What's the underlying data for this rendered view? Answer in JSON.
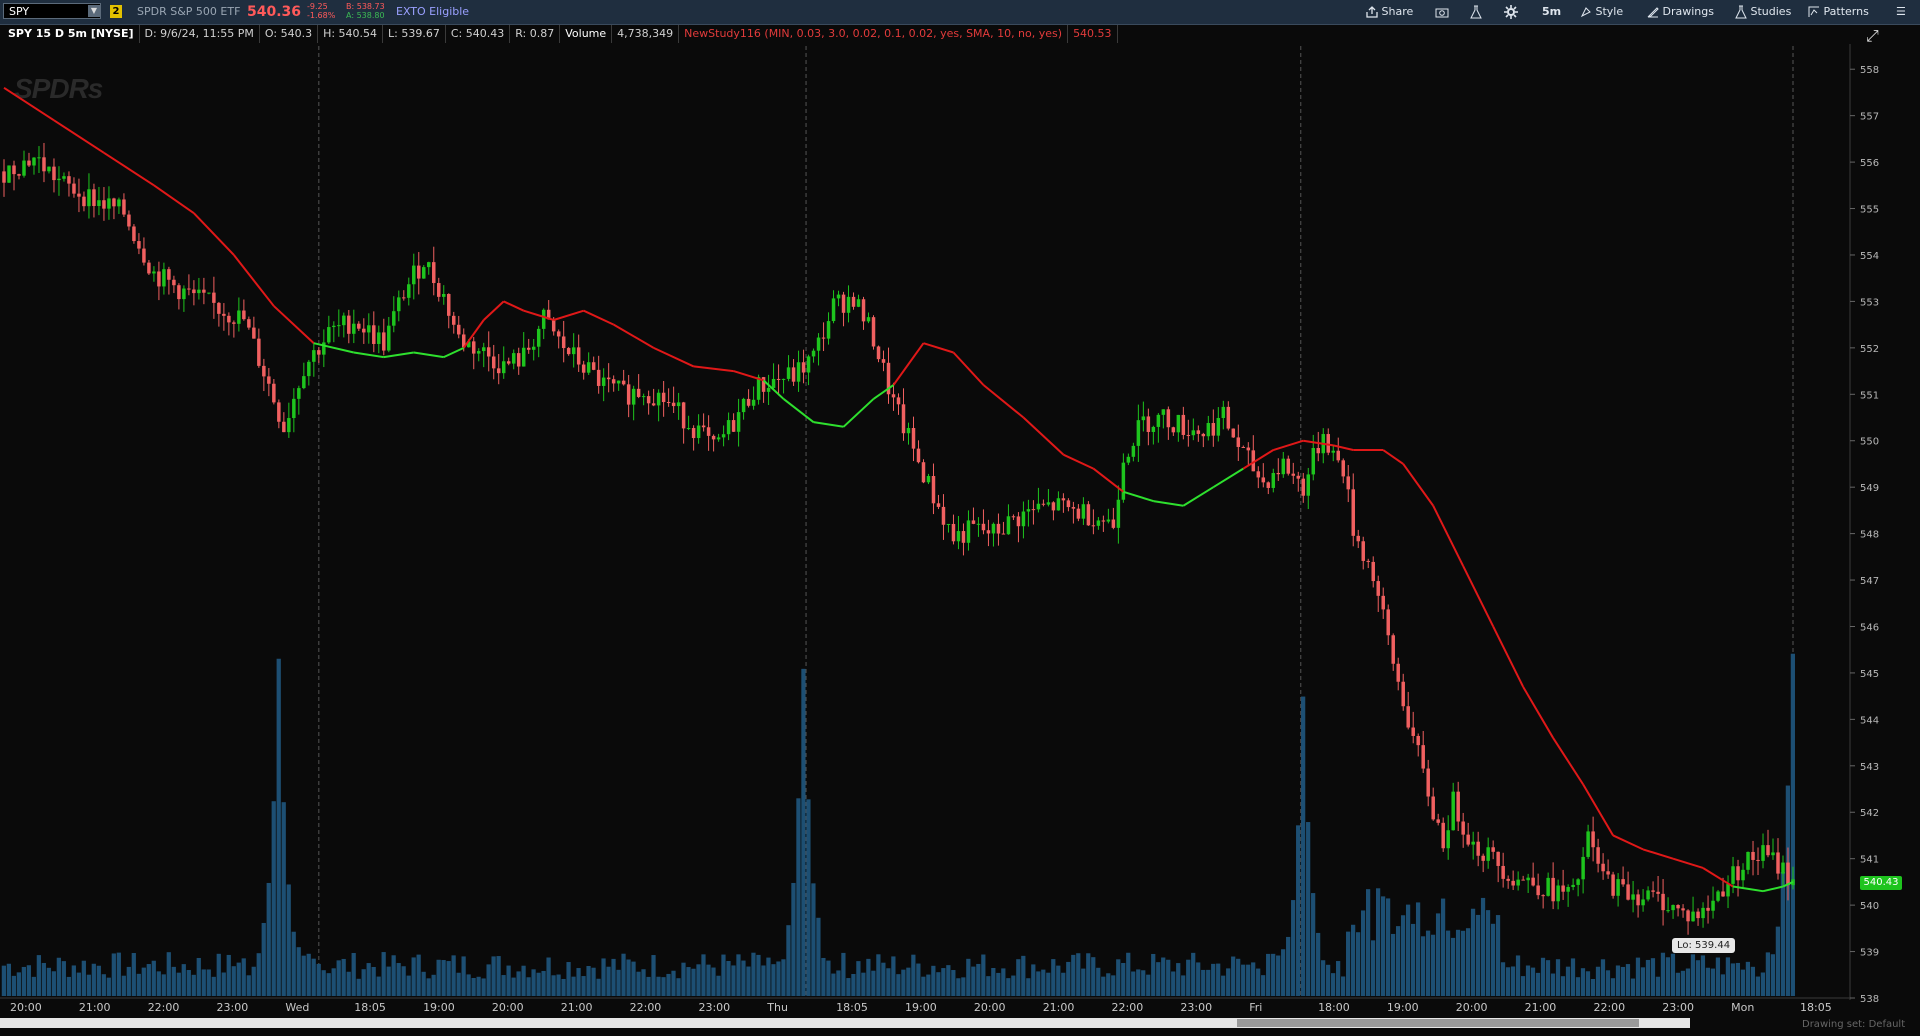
{
  "toolbar": {
    "symbol": "SPY",
    "link_badge": "2",
    "description": "SPDR S&P 500 ETF",
    "last_price": "540.36",
    "net_change": "-9.25",
    "pct_change": "-1.68%",
    "bid": "B: 538.73",
    "ask": "A: 538.80",
    "exto": "EXTO Eligible",
    "share_label": "Share",
    "aggregation": "5m",
    "style_label": "Style",
    "drawings_label": "Drawings",
    "studies_label": "Studies",
    "patterns_label": "Patterns"
  },
  "infobar": {
    "title": "SPY 15 D 5m [NYSE]",
    "date": "D: 9/6/24, 11:55 PM",
    "open": "O: 540.3",
    "high": "H: 540.54",
    "low": "L: 539.67",
    "close": "C: 540.43",
    "range": "R: 0.87",
    "volume_label": "Volume",
    "volume_value": "4,738,349",
    "study_label": "NewStudy116 (MIN, 0.03, 3.0, 0.02, 0.1, 0.02, yes, SMA, 10, no, yes)",
    "study_value": "540.53"
  },
  "watermark": "SPDRs",
  "price_tag": "540.43",
  "low_tag": "Lo: 539.44",
  "drawing_set": "Drawing set: Default",
  "colors": {
    "up": "#1ec41e",
    "down": "#f06060",
    "ma_red": "#e01818",
    "ma_green": "#2ee02e",
    "volume": "#1d4f73"
  },
  "chart_data": {
    "type": "candlestick",
    "symbol": "SPY",
    "interval": "5m",
    "ylim": [
      538,
      558.5
    ],
    "y_ticks": [
      "558",
      "557",
      "556",
      "555",
      "554",
      "553",
      "552",
      "551",
      "550",
      "549",
      "548",
      "547",
      "546",
      "545",
      "544",
      "543",
      "542",
      "541",
      "540",
      "539",
      "538"
    ],
    "x_ticks": [
      "20:00",
      "21:00",
      "22:00",
      "23:00",
      "Wed",
      "18:05",
      "19:00",
      "20:00",
      "21:00",
      "22:00",
      "23:00",
      "Thu",
      "18:05",
      "19:00",
      "20:00",
      "21:00",
      "22:00",
      "23:00",
      "Fri",
      "18:00",
      "19:00",
      "20:00",
      "21:00",
      "22:00",
      "23:00",
      "Mon",
      "18:05"
    ],
    "session_breaks": [
      "Wed",
      "Thu",
      "Fri",
      "Mon"
    ],
    "price_path": [
      [
        0,
        555.8
      ],
      [
        6,
        556.1
      ],
      [
        12,
        555.5
      ],
      [
        18,
        555.2
      ],
      [
        24,
        554.9
      ],
      [
        30,
        553.6
      ],
      [
        36,
        553.2
      ],
      [
        42,
        552.9
      ],
      [
        48,
        552.6
      ],
      [
        53,
        551.2
      ],
      [
        56,
        550.3
      ],
      [
        60,
        551.6
      ],
      [
        65,
        552.3
      ],
      [
        70,
        552.6
      ],
      [
        76,
        552.1
      ],
      [
        80,
        553.2
      ],
      [
        84,
        553.9
      ],
      [
        88,
        553.1
      ],
      [
        91,
        552.2
      ],
      [
        96,
        551.9
      ],
      [
        100,
        551.6
      ],
      [
        104,
        551.8
      ],
      [
        108,
        552.6
      ],
      [
        112,
        552.0
      ],
      [
        116,
        551.6
      ],
      [
        120,
        551.2
      ],
      [
        124,
        551.0
      ],
      [
        128,
        551.1
      ],
      [
        132,
        550.9
      ],
      [
        136,
        550.5
      ],
      [
        140,
        550.1
      ],
      [
        142,
        549.8
      ],
      [
        146,
        550.4
      ],
      [
        150,
        551.1
      ],
      [
        154,
        551.3
      ],
      [
        158,
        551.4
      ],
      [
        162,
        551.8
      ],
      [
        166,
        552.9
      ],
      [
        170,
        553.1
      ],
      [
        174,
        552.2
      ],
      [
        178,
        550.8
      ],
      [
        182,
        549.8
      ],
      [
        186,
        548.8
      ],
      [
        190,
        547.9
      ],
      [
        194,
        548.1
      ],
      [
        198,
        548.0
      ],
      [
        202,
        548.3
      ],
      [
        206,
        548.5
      ],
      [
        210,
        548.6
      ],
      [
        214,
        548.5
      ],
      [
        218,
        548.4
      ],
      [
        222,
        548.2
      ],
      [
        224,
        549.7
      ],
      [
        228,
        550.4
      ],
      [
        232,
        550.5
      ],
      [
        236,
        550.3
      ],
      [
        240,
        550.2
      ],
      [
        244,
        550.5
      ],
      [
        248,
        549.7
      ],
      [
        252,
        549.1
      ],
      [
        256,
        549.5
      ],
      [
        260,
        549.0
      ],
      [
        264,
        550.2
      ],
      [
        266,
        549.7
      ],
      [
        268,
        549.4
      ],
      [
        270,
        548.1
      ],
      [
        274,
        547.1
      ],
      [
        278,
        545.2
      ],
      [
        282,
        543.6
      ],
      [
        286,
        542.0
      ],
      [
        288,
        541.4
      ],
      [
        290,
        542.2
      ],
      [
        294,
        541.3
      ],
      [
        298,
        541.0
      ],
      [
        302,
        540.6
      ],
      [
        306,
        540.5
      ],
      [
        310,
        540.3
      ],
      [
        314,
        540.2
      ],
      [
        317,
        541.4
      ],
      [
        320,
        540.6
      ],
      [
        324,
        540.3
      ],
      [
        328,
        540.2
      ],
      [
        332,
        540.1
      ],
      [
        336,
        539.8
      ],
      [
        340,
        539.8
      ],
      [
        344,
        540.4
      ],
      [
        348,
        540.9
      ],
      [
        352,
        541.1
      ],
      [
        356,
        540.8
      ],
      [
        358,
        540.4
      ]
    ],
    "moving_average": [
      [
        0,
        557.6
      ],
      [
        10,
        556.9
      ],
      [
        20,
        556.2
      ],
      [
        30,
        555.5
      ],
      [
        38,
        554.9
      ],
      [
        46,
        554.0
      ],
      [
        54,
        552.9
      ],
      [
        62,
        552.1
      ],
      [
        70,
        551.9
      ],
      [
        76,
        551.8
      ],
      [
        82,
        551.9
      ],
      [
        88,
        551.8
      ],
      [
        92,
        552.0
      ],
      [
        96,
        552.6
      ],
      [
        100,
        553.0
      ],
      [
        104,
        552.8
      ],
      [
        110,
        552.6
      ],
      [
        116,
        552.8
      ],
      [
        122,
        552.5
      ],
      [
        130,
        552.0
      ],
      [
        138,
        551.6
      ],
      [
        146,
        551.5
      ],
      [
        152,
        551.3
      ],
      [
        156,
        550.9
      ],
      [
        162,
        550.4
      ],
      [
        168,
        550.3
      ],
      [
        174,
        550.9
      ],
      [
        178,
        551.2
      ],
      [
        184,
        552.1
      ],
      [
        190,
        551.9
      ],
      [
        196,
        551.2
      ],
      [
        204,
        550.5
      ],
      [
        212,
        549.7
      ],
      [
        218,
        549.4
      ],
      [
        224,
        548.9
      ],
      [
        230,
        548.7
      ],
      [
        236,
        548.6
      ],
      [
        242,
        549.0
      ],
      [
        248,
        549.4
      ],
      [
        254,
        549.8
      ],
      [
        260,
        550.0
      ],
      [
        266,
        549.9
      ],
      [
        270,
        549.8
      ],
      [
        276,
        549.8
      ],
      [
        280,
        549.5
      ],
      [
        286,
        548.6
      ],
      [
        292,
        547.3
      ],
      [
        298,
        546.0
      ],
      [
        304,
        544.7
      ],
      [
        310,
        543.6
      ],
      [
        316,
        542.6
      ],
      [
        322,
        541.5
      ],
      [
        328,
        541.2
      ],
      [
        334,
        541.0
      ],
      [
        340,
        540.8
      ],
      [
        346,
        540.4
      ],
      [
        352,
        540.3
      ],
      [
        356,
        540.4
      ],
      [
        358,
        540.5
      ]
    ],
    "volume_peaks": [
      {
        "x": 55,
        "rel": 0.95
      },
      {
        "x": 160,
        "rel": 0.94
      },
      {
        "x": 260,
        "rel": 0.84
      },
      {
        "x": 358,
        "rel": 1.0
      }
    ]
  }
}
